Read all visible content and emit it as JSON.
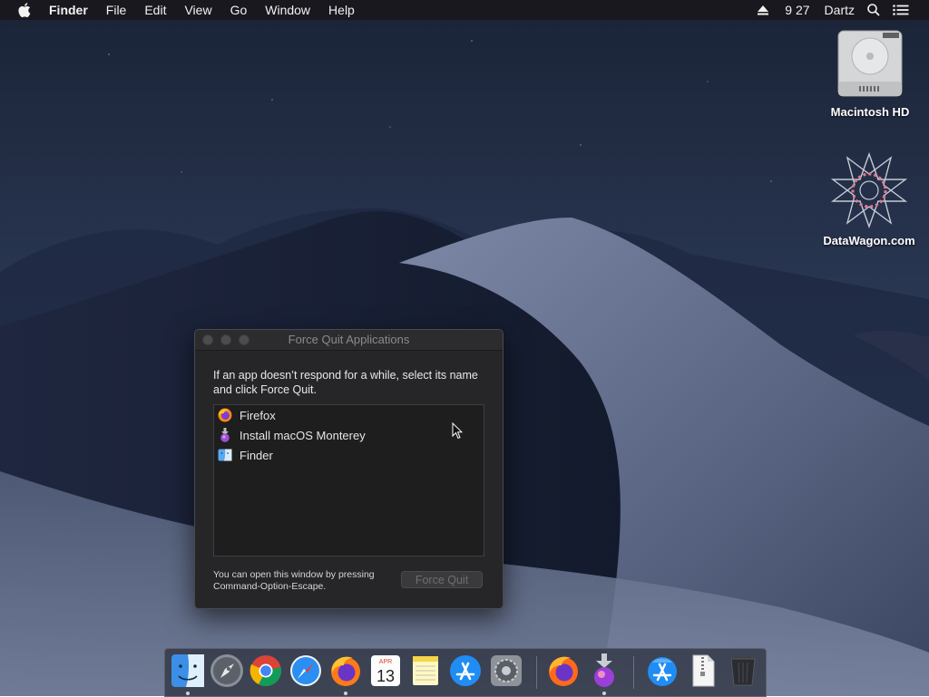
{
  "menubar": {
    "apple_icon": "apple-icon",
    "app_name": "Finder",
    "menus": [
      "File",
      "Edit",
      "View",
      "Go",
      "Window",
      "Help"
    ],
    "clock": "9 27",
    "user": "Dartz",
    "status_icons": [
      "eject-icon",
      "search-icon",
      "list-icon"
    ]
  },
  "desktop": {
    "icons": [
      {
        "label": "Macintosh HD",
        "icon": "hard-drive-icon"
      },
      {
        "label": "DataWagon.com",
        "icon": "datawagon-logo-icon"
      }
    ]
  },
  "force_quit": {
    "title": "Force Quit Applications",
    "description": "If an app doesn’t respond for a while, select its name and click Force Quit.",
    "apps": [
      {
        "name": "Firefox",
        "icon": "firefox-icon"
      },
      {
        "name": "Install macOS Monterey",
        "icon": "install-macos-icon"
      },
      {
        "name": "Finder",
        "icon": "finder-icon"
      }
    ],
    "hint_line1": "You can open this window by pressing",
    "hint_line2": "Command-Option-Escape.",
    "button_label": "Force Quit"
  },
  "dock": {
    "items": [
      {
        "icon": "finder-icon",
        "running": true
      },
      {
        "icon": "launchpad-icon",
        "running": false
      },
      {
        "icon": "chrome-icon",
        "running": false
      },
      {
        "icon": "safari-icon",
        "running": false
      },
      {
        "icon": "firefox-icon",
        "running": true
      },
      {
        "icon": "calendar-icon",
        "running": false,
        "month": "APR",
        "day": "13"
      },
      {
        "icon": "notes-icon",
        "running": false
      },
      {
        "icon": "app-store-icon",
        "running": false
      },
      {
        "icon": "system-preferences-icon",
        "running": false
      },
      {
        "icon": "firefox-icon",
        "running": false
      },
      {
        "icon": "install-macos-icon",
        "running": true
      },
      {
        "icon": "applications-folder-icon",
        "running": false
      },
      {
        "icon": "archive-file-icon",
        "running": false
      },
      {
        "icon": "trash-icon",
        "running": false
      }
    ]
  },
  "colors": {
    "window_bg": "#262628",
    "list_bg": "#1e1e1f",
    "menubar_bg": "#18181c"
  }
}
